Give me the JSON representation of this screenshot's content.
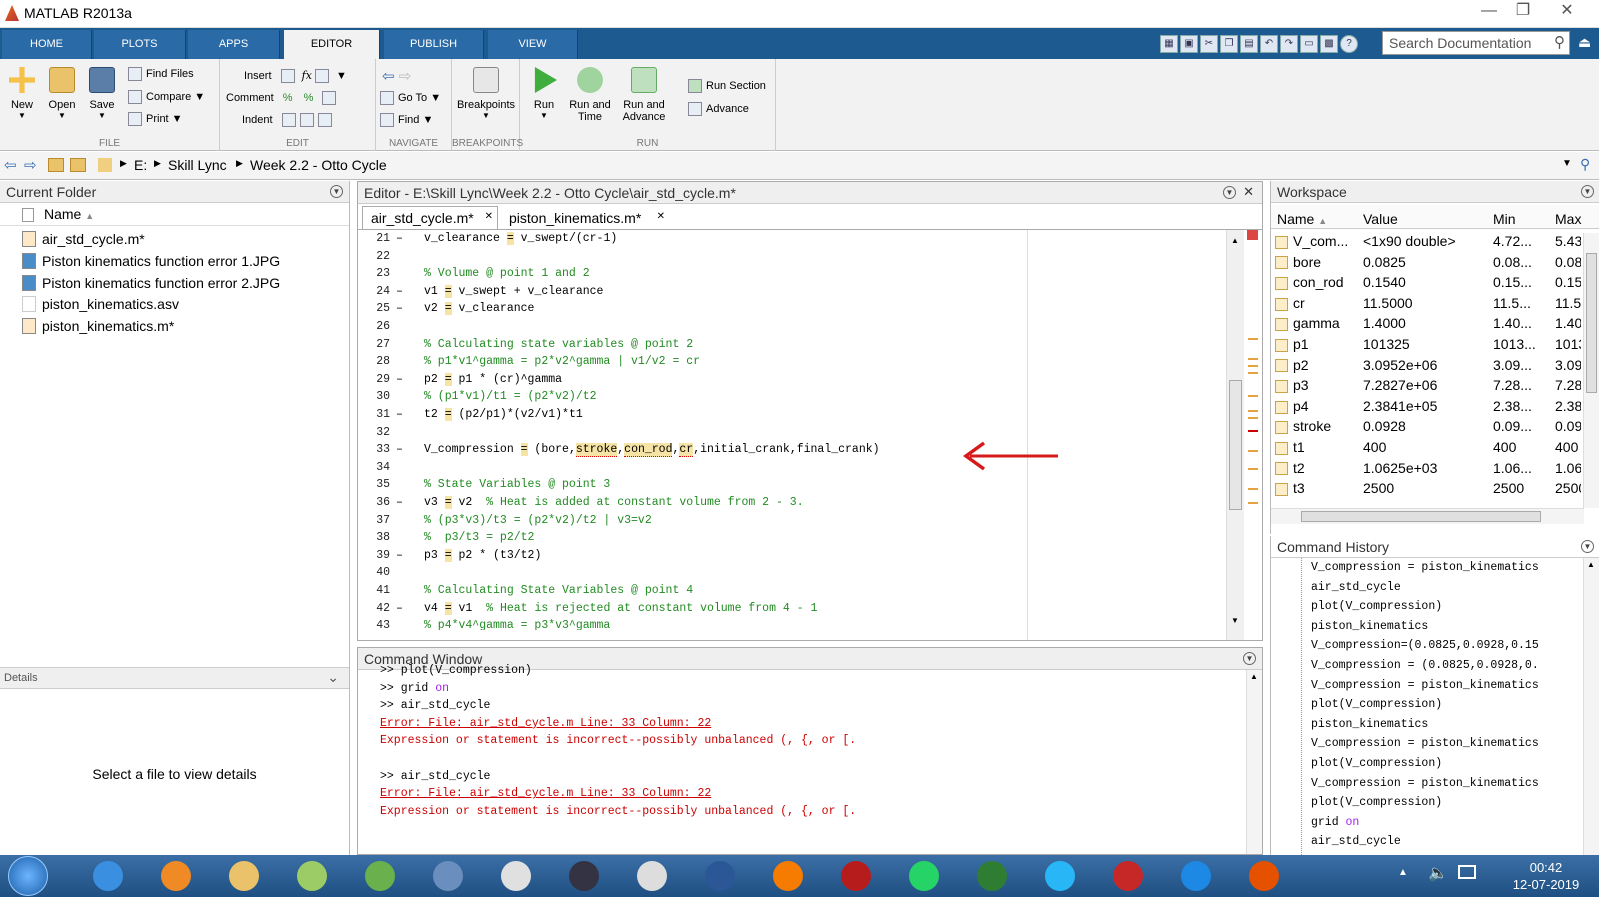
{
  "app": {
    "title": "MATLAB R2013a"
  },
  "ribbon_tabs": [
    "HOME",
    "PLOTS",
    "APPS",
    "EDITOR",
    "PUBLISH",
    "VIEW"
  ],
  "search": {
    "placeholder": "Search Documentation"
  },
  "toolstrip": {
    "file": {
      "label": "FILE",
      "new": "New",
      "open": "Open",
      "save": "Save",
      "find_files": "Find Files",
      "compare": "Compare",
      "print": "Print"
    },
    "edit": {
      "label": "EDIT",
      "insert": "Insert",
      "comment": "Comment",
      "indent": "Indent",
      "fx": "fx"
    },
    "navigate": {
      "label": "NAVIGATE",
      "goto": "Go To",
      "find": "Find"
    },
    "breakpoints": {
      "label": "BREAKPOINTS",
      "btn": "Breakpoints"
    },
    "run": {
      "label": "RUN",
      "run": "Run",
      "run_time": "Run and Time",
      "run_advance": "Run and Advance",
      "run_section": "Run Section",
      "advance": "Advance"
    }
  },
  "path": {
    "drive": "E:",
    "folder1": "Skill Lync",
    "folder2": "Week 2.2 - Otto Cycle"
  },
  "current_folder": {
    "title": "Current Folder",
    "column": "Name",
    "files": [
      "air_std_cycle.m*",
      "Piston kinematics function error 1.JPG",
      "Piston kinematics function error 2.JPG",
      "piston_kinematics.asv",
      "piston_kinematics.m*"
    ],
    "details_title": "Details",
    "details_msg": "Select a file to view details"
  },
  "editor": {
    "title": "Editor - E:\\Skill Lync\\Week 2.2 - Otto Cycle\\air_std_cycle.m*",
    "tabs": [
      "air_std_cycle.m*",
      "piston_kinematics.m*"
    ],
    "lines": [
      {
        "n": "21",
        "d": "–",
        "code": "v_clearance = v_swept/(cr-1)",
        "type": "code"
      },
      {
        "n": "22",
        "d": "",
        "code": "",
        "type": "code"
      },
      {
        "n": "23",
        "d": "",
        "code": "% Volume @ point 1 and 2",
        "type": "comment"
      },
      {
        "n": "24",
        "d": "–",
        "code": "v1 = v_swept + v_clearance",
        "type": "code"
      },
      {
        "n": "25",
        "d": "–",
        "code": "v2 = v_clearance",
        "type": "code"
      },
      {
        "n": "26",
        "d": "",
        "code": "",
        "type": "code"
      },
      {
        "n": "27",
        "d": "",
        "code": "% Calculating state variables @ point 2",
        "type": "comment"
      },
      {
        "n": "28",
        "d": "",
        "code": "% p1*v1^gamma = p2*v2^gamma | v1/v2 = cr",
        "type": "comment"
      },
      {
        "n": "29",
        "d": "–",
        "code": "p2 = p1 * (cr)^gamma",
        "type": "code"
      },
      {
        "n": "30",
        "d": "",
        "code": "% (p1*v1)/t1 = (p2*v2)/t2",
        "type": "comment"
      },
      {
        "n": "31",
        "d": "–",
        "code": "t2 = (p2/p1)*(v2/v1)*t1",
        "type": "code"
      },
      {
        "n": "32",
        "d": "",
        "code": "",
        "type": "code"
      },
      {
        "n": "33",
        "d": "–",
        "code": "V_compression = (bore,stroke,con_rod,cr,initial_crank,final_crank)",
        "type": "code"
      },
      {
        "n": "34",
        "d": "",
        "code": "",
        "type": "code"
      },
      {
        "n": "35",
        "d": "",
        "code": "% State Variables @ point 3",
        "type": "comment"
      },
      {
        "n": "36",
        "d": "–",
        "code": "v3 = v2  % Heat is added at constant volume from 2 - 3.",
        "type": "code"
      },
      {
        "n": "37",
        "d": "",
        "code": "% (p3*v3)/t3 = (p2*v2)/t2 | v3=v2",
        "type": "comment"
      },
      {
        "n": "38",
        "d": "",
        "code": "%  p3/t3 = p2/t2",
        "type": "comment"
      },
      {
        "n": "39",
        "d": "–",
        "code": "p3 = p2 * (t3/t2)",
        "type": "code"
      },
      {
        "n": "40",
        "d": "",
        "code": "",
        "type": "code"
      },
      {
        "n": "41",
        "d": "",
        "code": "% Calculating State Variables @ point 4",
        "type": "comment"
      },
      {
        "n": "42",
        "d": "–",
        "code": "v4 = v1  % Heat is rejected at constant volume from 4 - 1",
        "type": "code"
      },
      {
        "n": "43",
        "d": "",
        "code": "% p4*v4^gamma = p3*v3^gamma",
        "type": "comment"
      }
    ]
  },
  "command_window": {
    "title": "Command Window",
    "lines": [
      ">> plot(V_compression)",
      ">> grid on",
      ">> air_std_cycle",
      "Error: File: air_std_cycle.m Line: 33 Column: 22",
      "Expression or statement is incorrect--possibly unbalanced (, {, or [.",
      "",
      ">> air_std_cycle",
      "Error: File: air_std_cycle.m Line: 33 Column: 22",
      "Expression or statement is incorrect--possibly unbalanced (, {, or [."
    ]
  },
  "workspace": {
    "title": "Workspace",
    "columns": [
      "Name",
      "Value",
      "Min",
      "Max"
    ],
    "rows": [
      [
        "V_com...",
        "<1x90 double>",
        "4.72...",
        "5.43..."
      ],
      [
        "bore",
        "0.0825",
        "0.08...",
        "0.08..."
      ],
      [
        "con_rod",
        "0.1540",
        "0.15...",
        "0.15..."
      ],
      [
        "cr",
        "11.5000",
        "11.5...",
        "11.5..."
      ],
      [
        "gamma",
        "1.4000",
        "1.40...",
        "1.40..."
      ],
      [
        "p1",
        "101325",
        "1013...",
        "1013..."
      ],
      [
        "p2",
        "3.0952e+06",
        "3.09...",
        "3.09..."
      ],
      [
        "p3",
        "7.2827e+06",
        "7.28...",
        "7.28..."
      ],
      [
        "p4",
        "2.3841e+05",
        "2.38...",
        "2.38..."
      ],
      [
        "stroke",
        "0.0928",
        "0.09...",
        "0.09..."
      ],
      [
        "t1",
        "400",
        "400",
        "400"
      ],
      [
        "t2",
        "1.0625e+03",
        "1.06...",
        "1.06..."
      ],
      [
        "t3",
        "2500",
        "2500",
        "2500"
      ]
    ]
  },
  "command_history": {
    "title": "Command History",
    "items": [
      "V_compression = piston_kinematics",
      "air_std_cycle",
      "plot(V_compression)",
      "piston_kinematics",
      "V_compression=(0.0825,0.0928,0.15",
      "V_compression = (0.0825,0.0928,0.",
      "V_compression = piston_kinematics",
      "plot(V_compression)",
      "piston_kinematics",
      "V_compression = piston_kinematics",
      "plot(V_compression)",
      "V_compression = piston_kinematics",
      "plot(V_compression)",
      "grid on",
      "air_std_cycle"
    ]
  },
  "taskbar": {
    "time": "00:42",
    "date": "12-07-2019",
    "apps": [
      "ie-icon",
      "media-player-icon",
      "explorer-icon",
      "notepad-icon",
      "utorrent-icon",
      "network-icon",
      "chrome-icon",
      "devcpp-icon",
      "snipping-icon",
      "word-icon",
      "vlc-icon",
      "autocad-icon",
      "whatsapp-icon",
      "excel-icon",
      "sync-icon",
      "paint-icon",
      "catia-icon",
      "matlab-icon"
    ]
  },
  "colors": {
    "ribbon_tab": "#1d5a90",
    "comment": "#228b22",
    "error": "#cc0000",
    "keyword": "#a020f0",
    "highlight": "#f6e4a6",
    "arrow": "#d7191c"
  }
}
